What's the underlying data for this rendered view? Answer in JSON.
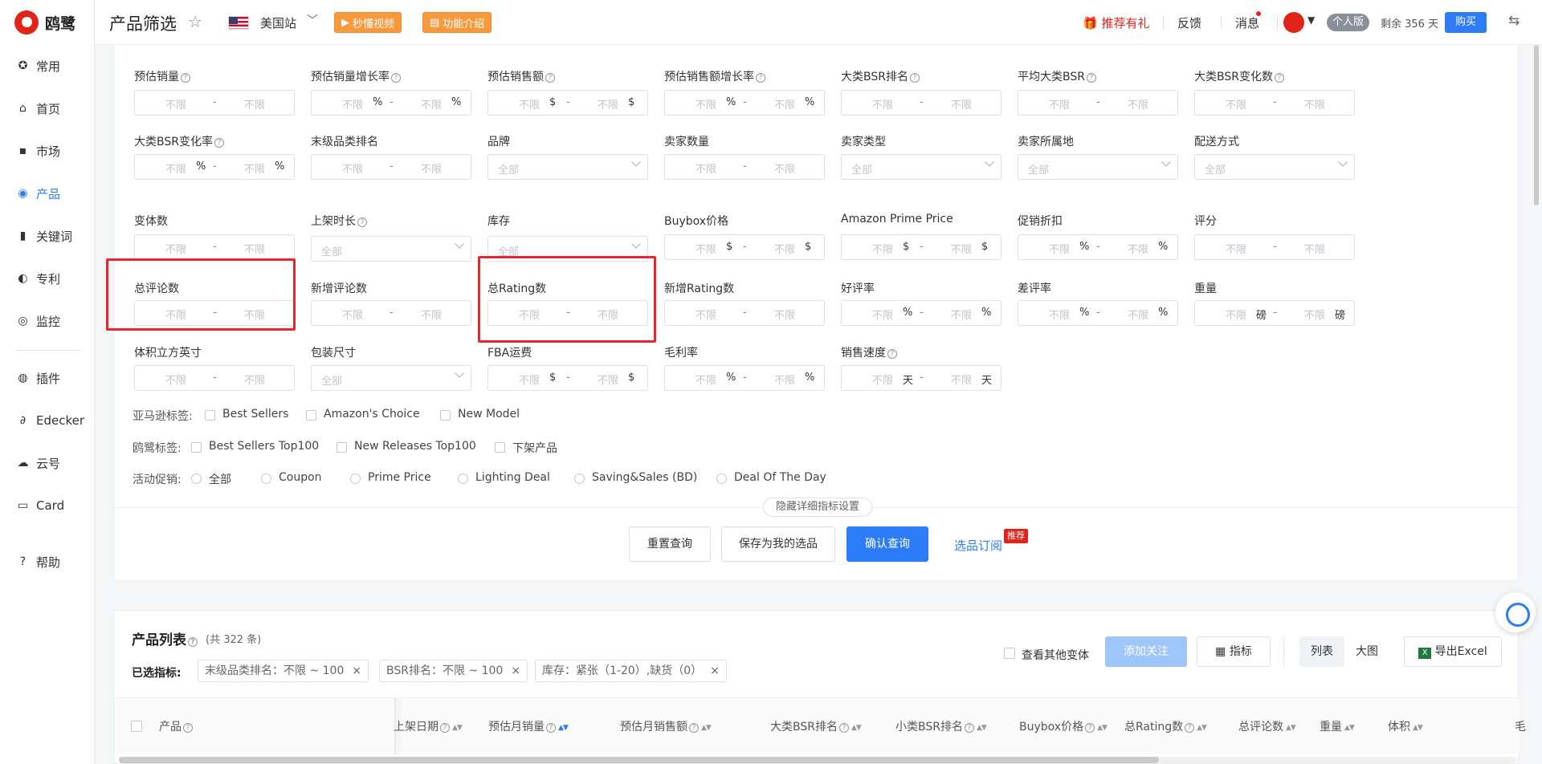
{
  "brand": {
    "name": "鸥鹭"
  },
  "sidebar": {
    "items": [
      {
        "label": "常用",
        "icon": "star-icon"
      },
      {
        "label": "首页",
        "icon": "home-icon"
      },
      {
        "label": "市场",
        "icon": "market-icon"
      },
      {
        "label": "产品",
        "icon": "eye-icon",
        "active": true
      },
      {
        "label": "关键词",
        "icon": "chart-icon"
      },
      {
        "label": "专利",
        "icon": "patent-icon"
      },
      {
        "label": "监控",
        "icon": "monitor-icon"
      },
      {
        "label": "插件",
        "icon": "chrome-icon"
      },
      {
        "label": "Edecker",
        "icon": "edecker-icon"
      },
      {
        "label": "云号",
        "icon": "cloud-icon"
      },
      {
        "label": "Card",
        "icon": "card-icon"
      },
      {
        "label": "帮助",
        "icon": "help-icon"
      }
    ]
  },
  "header": {
    "title": "产品筛选",
    "site": "美国站",
    "video_btn": "秒懂视频",
    "intro_btn": "功能介绍",
    "referral": "推荐有礼",
    "feedback": "反馈",
    "messages": "消息",
    "plan": "个人版",
    "remaining": "剩余 356 天",
    "buy": "购买"
  },
  "filters": {
    "fields": [
      {
        "label": "预估销量",
        "help": true,
        "type": "range",
        "min": "不限",
        "max": "不限"
      },
      {
        "label": "预估销量增长率",
        "help": true,
        "type": "range",
        "min": "不限",
        "max": "不限",
        "unit": "%"
      },
      {
        "label": "预估销售额",
        "help": true,
        "type": "range",
        "min": "不限",
        "max": "不限",
        "unit": "$"
      },
      {
        "label": "预估销售额增长率",
        "help": true,
        "type": "range",
        "min": "不限",
        "max": "不限",
        "unit": "%"
      },
      {
        "label": "大类BSR排名",
        "help": true,
        "type": "range",
        "min": "不限",
        "max": "不限"
      },
      {
        "label": "平均大类BSR",
        "help": true,
        "type": "range",
        "min": "不限",
        "max": "不限"
      },
      {
        "label": "大类BSR变化数",
        "help": true,
        "type": "range",
        "min": "不限",
        "max": "不限"
      },
      {
        "label": "大类BSR变化率",
        "help": true,
        "type": "range",
        "min": "不限",
        "max": "不限",
        "unit": "%"
      },
      {
        "label": "末级品类排名",
        "help": false,
        "type": "range",
        "min": "不限",
        "max": "不限"
      },
      {
        "label": "品牌",
        "help": false,
        "type": "select",
        "value": "全部"
      },
      {
        "label": "卖家数量",
        "help": false,
        "type": "range",
        "min": "不限",
        "max": "不限"
      },
      {
        "label": "卖家类型",
        "help": false,
        "type": "select",
        "value": "全部"
      },
      {
        "label": "卖家所属地",
        "help": false,
        "type": "select",
        "value": "全部"
      },
      {
        "label": "配送方式",
        "help": false,
        "type": "select",
        "value": "全部"
      },
      {
        "label": "变体数",
        "help": false,
        "type": "range",
        "min": "不限",
        "max": "不限"
      },
      {
        "label": "上架时长",
        "help": true,
        "type": "select",
        "value": "全部"
      },
      {
        "label": "库存",
        "help": false,
        "type": "select",
        "value": "全部"
      },
      {
        "label": "Buybox价格",
        "help": false,
        "type": "range",
        "min": "不限",
        "max": "不限",
        "unit": "$"
      },
      {
        "label": "Amazon Prime Price",
        "help": false,
        "type": "range",
        "min": "不限",
        "max": "不限",
        "unit": "$"
      },
      {
        "label": "促销折扣",
        "help": false,
        "type": "range",
        "min": "不限",
        "max": "不限",
        "unit": "%"
      },
      {
        "label": "评分",
        "help": false,
        "type": "range",
        "min": "不限",
        "max": "不限"
      },
      {
        "label": "总评论数",
        "help": false,
        "type": "range",
        "min": "不限",
        "max": "不限"
      },
      {
        "label": "新增评论数",
        "help": false,
        "type": "range",
        "min": "不限",
        "max": "不限"
      },
      {
        "label": "总Rating数",
        "help": false,
        "type": "range",
        "min": "不限",
        "max": "不限"
      },
      {
        "label": "新增Rating数",
        "help": false,
        "type": "range",
        "min": "不限",
        "max": "不限"
      },
      {
        "label": "好评率",
        "help": false,
        "type": "range",
        "min": "不限",
        "max": "不限",
        "unit": "%"
      },
      {
        "label": "差评率",
        "help": false,
        "type": "range",
        "min": "不限",
        "max": "不限",
        "unit": "%"
      },
      {
        "label": "重量",
        "help": false,
        "type": "range",
        "min": "不限",
        "max": "不限",
        "unit": "磅"
      },
      {
        "label": "体积立方英寸",
        "help": false,
        "type": "range",
        "min": "不限",
        "max": "不限"
      },
      {
        "label": "包装尺寸",
        "help": false,
        "type": "select",
        "value": "全部"
      },
      {
        "label": "FBA运费",
        "help": false,
        "type": "range",
        "min": "不限",
        "max": "不限",
        "unit": "$"
      },
      {
        "label": "毛利率",
        "help": false,
        "type": "range",
        "min": "不限",
        "max": "不限",
        "unit": "%"
      },
      {
        "label": "销售速度",
        "help": true,
        "type": "range",
        "min": "不限",
        "max": "不限",
        "unit": "天"
      }
    ],
    "amazon_tags": {
      "label": "亚马逊标签:",
      "options": [
        "Best Sellers",
        "Amazon's Choice",
        "New Model"
      ]
    },
    "oulu_tags": {
      "label": "鸥鹭标签:",
      "options": [
        "Best Sellers Top100",
        "New Releases Top100",
        "下架产品"
      ]
    },
    "promotions": {
      "label": "活动促销:",
      "options": [
        "全部",
        "Coupon",
        "Prime Price",
        "Lighting Deal",
        "Saving&Sales (BD)",
        "Deal Of The Day"
      ]
    },
    "collapse": "隐藏详细指标设置",
    "reset": "重置查询",
    "save": "保存为我的选品",
    "confirm": "确认查询",
    "subscribe": "选品订阅",
    "hot": "推荐"
  },
  "product_list": {
    "title": "产品列表",
    "count": "(共 322 条)",
    "selected_label": "已选指标:",
    "chips": [
      "末级品类排名：不限 ~ 100",
      "BSR排名：不限 ~ 100",
      "库存：紧张（1-20）,缺货（0）"
    ],
    "other_variants": "查看其他变体",
    "add_follow": "添加关注",
    "metrics": "指标",
    "view_list": "列表",
    "view_grid": "大图",
    "export": "导出Excel",
    "columns": [
      "产品",
      "上架日期",
      "预估月销量",
      "预估月销售额",
      "大类BSR排名",
      "小类BSR排名",
      "Buybox价格",
      "总Rating数",
      "总评论数",
      "重量",
      "体积",
      "毛"
    ]
  }
}
